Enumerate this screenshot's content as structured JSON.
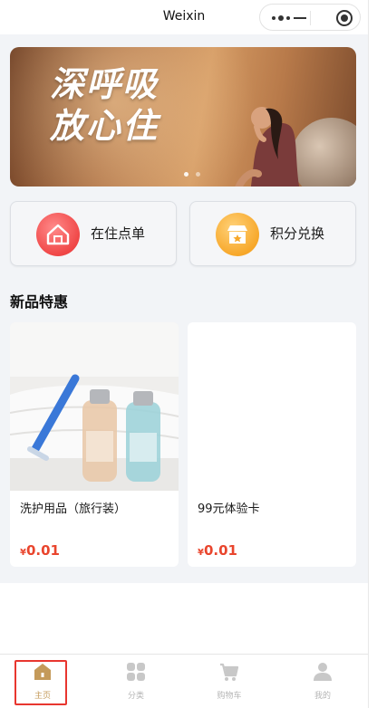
{
  "navbar": {
    "title": "Weixin"
  },
  "banner": {
    "headline_line1": "深呼吸",
    "headline_line2": "放心住"
  },
  "quick_actions": [
    {
      "label": "在住点单",
      "icon": "house-icon",
      "color": "#f04747"
    },
    {
      "label": "积分兑换",
      "icon": "store-icon",
      "color": "#f7a82b"
    }
  ],
  "section": {
    "title": "新品特惠"
  },
  "products": [
    {
      "name": "洗护用品（旅行装）",
      "currency": "¥",
      "price": "0.01"
    },
    {
      "name": "99元体验卡",
      "currency": "¥",
      "price": "0.01"
    }
  ],
  "tabbar": {
    "items": [
      {
        "label": "主页",
        "icon": "home-icon",
        "active": true
      },
      {
        "label": "分类",
        "icon": "category-icon",
        "active": false
      },
      {
        "label": "购物车",
        "icon": "cart-icon",
        "active": false
      },
      {
        "label": "我的",
        "icon": "user-icon",
        "active": false
      }
    ]
  },
  "colors": {
    "accent": "#c49a5a",
    "price": "#e9452d",
    "highlight_box": "#e8362f"
  }
}
